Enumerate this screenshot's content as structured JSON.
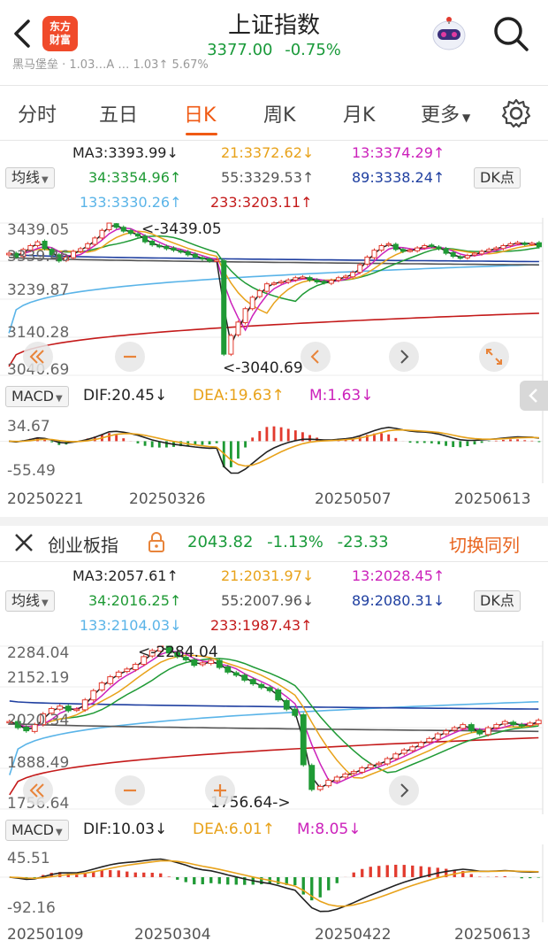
{
  "header": {
    "logo_line1": "东方",
    "logo_line2": "财富",
    "title": "上证指数",
    "price": "3377.00",
    "change_pct": "-0.75%",
    "ticker": "黑马堡垒 · 1.03…A … 1.03↑ 5.67%"
  },
  "tabs": [
    {
      "label": "分时"
    },
    {
      "label": "五日"
    },
    {
      "label": "日K"
    },
    {
      "label": "周K"
    },
    {
      "label": "月K"
    },
    {
      "label": "更多"
    }
  ],
  "active_tab": "日K",
  "panel1": {
    "indicator_select": "均线",
    "dk_button": "DK点",
    "ma": {
      "ma3": "MA3:3393.99↓",
      "ma21": "21:3372.62↓",
      "ma13": "13:3374.29↑",
      "ma34": "34:3354.96↑",
      "ma55": "55:3329.53↑",
      "ma89": "89:3338.24↑",
      "ma133": "133:3330.26↑",
      "ma233": "233:3203.11↑"
    },
    "y_ticks": [
      "3439.05",
      "3339.46",
      "3239.87",
      "3140.28",
      "3040.69"
    ],
    "high_label": "<-3439.05",
    "low_label": "<-3040.69",
    "macd": {
      "selector": "MACD",
      "dif": "DIF:20.45↓",
      "dea": "DEA:19.63↑",
      "m": "M:1.63↓",
      "y_top": "34.67",
      "y_bottom": "-55.49"
    },
    "dates": [
      "20250221",
      "20250326",
      "20250507",
      "20250613"
    ]
  },
  "panel2": {
    "name": "创业板指",
    "price": "2043.82",
    "change_pct": "-1.13%",
    "change": "-23.33",
    "switch_label": "切换同列",
    "indicator_select": "均线",
    "dk_button": "DK点",
    "ma": {
      "ma3": "MA3:2057.61↑",
      "ma21": "21:2031.97↓",
      "ma13": "13:2028.45↑",
      "ma34": "34:2016.25↑",
      "ma55": "55:2007.96↓",
      "ma89": "89:2080.31↓",
      "ma133": "133:2104.03↓",
      "ma233": "233:1987.43↑"
    },
    "y_ticks": [
      "2284.04",
      "2152.19",
      "2020.34",
      "1888.49",
      "1756.64"
    ],
    "high_label": "<-2284.04",
    "low_label": "1756.64->",
    "macd": {
      "selector": "MACD",
      "dif": "DIF:10.03↓",
      "dea": "DEA:6.01↑",
      "m": "M:8.05↓",
      "y_top": "45.51",
      "y_bottom": "-92.16"
    },
    "dates": [
      "20250109",
      "20250304",
      "20250422",
      "20250613"
    ]
  },
  "colors": {
    "up": "#e23a2e",
    "down": "#1f9a35",
    "accent": "#f05a14",
    "ma3": "#222222",
    "ma21": "#e8a21a",
    "ma13": "#cc22bb",
    "ma34": "#1f9a35",
    "ma55": "#555555",
    "ma89": "#1f3fa0",
    "ma133": "#5ab4e8",
    "ma233": "#c41a1a"
  },
  "chart_data": [
    {
      "type": "candlestick",
      "title": "上证指数 日K",
      "x_dates": [
        "20250221",
        "20250326",
        "20250507",
        "20250613"
      ],
      "ylim": [
        3040.69,
        3439.05
      ],
      "close": [
        3360,
        3350,
        3370,
        3380,
        3390,
        3372,
        3356,
        3340,
        3350,
        3365,
        3372,
        3385,
        3400,
        3420,
        3439,
        3428,
        3418,
        3412,
        3405,
        3390,
        3382,
        3378,
        3372,
        3368,
        3364,
        3356,
        3350,
        3345,
        3340,
        3342,
        3096,
        3145,
        3180,
        3215,
        3245,
        3262,
        3280,
        3282,
        3286,
        3290,
        3296,
        3298,
        3290,
        3285,
        3283,
        3289,
        3296,
        3300,
        3310,
        3330,
        3350,
        3368,
        3380,
        3385,
        3370,
        3365,
        3368,
        3374,
        3380,
        3378,
        3372,
        3360,
        3352,
        3348,
        3354,
        3360,
        3365,
        3370,
        3374,
        3380,
        3385,
        3388,
        3384,
        3386,
        3377
      ],
      "ma_current": {
        "MA3": 3393.99,
        "MA13": 3374.29,
        "MA21": 3372.62,
        "MA34": 3354.96,
        "MA55": 3329.53,
        "MA89": 3338.24,
        "MA133": 3330.26,
        "MA233": 3203.11
      },
      "macd": {
        "DIF": 20.45,
        "DEA": 19.63,
        "M": 1.63,
        "ylim": [
          -55.49,
          34.67
        ]
      }
    },
    {
      "type": "candlestick",
      "title": "创业板指 日K",
      "x_dates": [
        "20250109",
        "20250304",
        "20250422",
        "20250613"
      ],
      "ylim": [
        1756.64,
        2284.04
      ],
      "close": [
        2040,
        2020,
        2010,
        2030,
        2065,
        2082,
        2090,
        2075,
        2080,
        2110,
        2140,
        2165,
        2185,
        2200,
        2210,
        2225,
        2250,
        2270,
        2284,
        2262,
        2250,
        2240,
        2222,
        2230,
        2238,
        2215,
        2200,
        2190,
        2174,
        2162,
        2150,
        2140,
        2110,
        2080,
        2060,
        1900,
        1820,
        1830,
        1850,
        1860,
        1870,
        1878,
        1890,
        1900,
        1905,
        1920,
        1935,
        1948,
        1958,
        1972,
        1985,
        2000,
        2010,
        2020,
        2030,
        2010,
        2000,
        2020,
        2030,
        2040,
        2030,
        2025,
        2035,
        2044
      ],
      "ma_current": {
        "MA3": 2057.61,
        "MA13": 2028.45,
        "MA21": 2031.97,
        "MA34": 2016.25,
        "MA55": 2007.96,
        "MA89": 2080.31,
        "MA133": 2104.03,
        "MA233": 1987.43
      },
      "macd": {
        "DIF": 10.03,
        "DEA": 6.01,
        "M": 8.05,
        "ylim": [
          -92.16,
          45.51
        ]
      }
    }
  ]
}
